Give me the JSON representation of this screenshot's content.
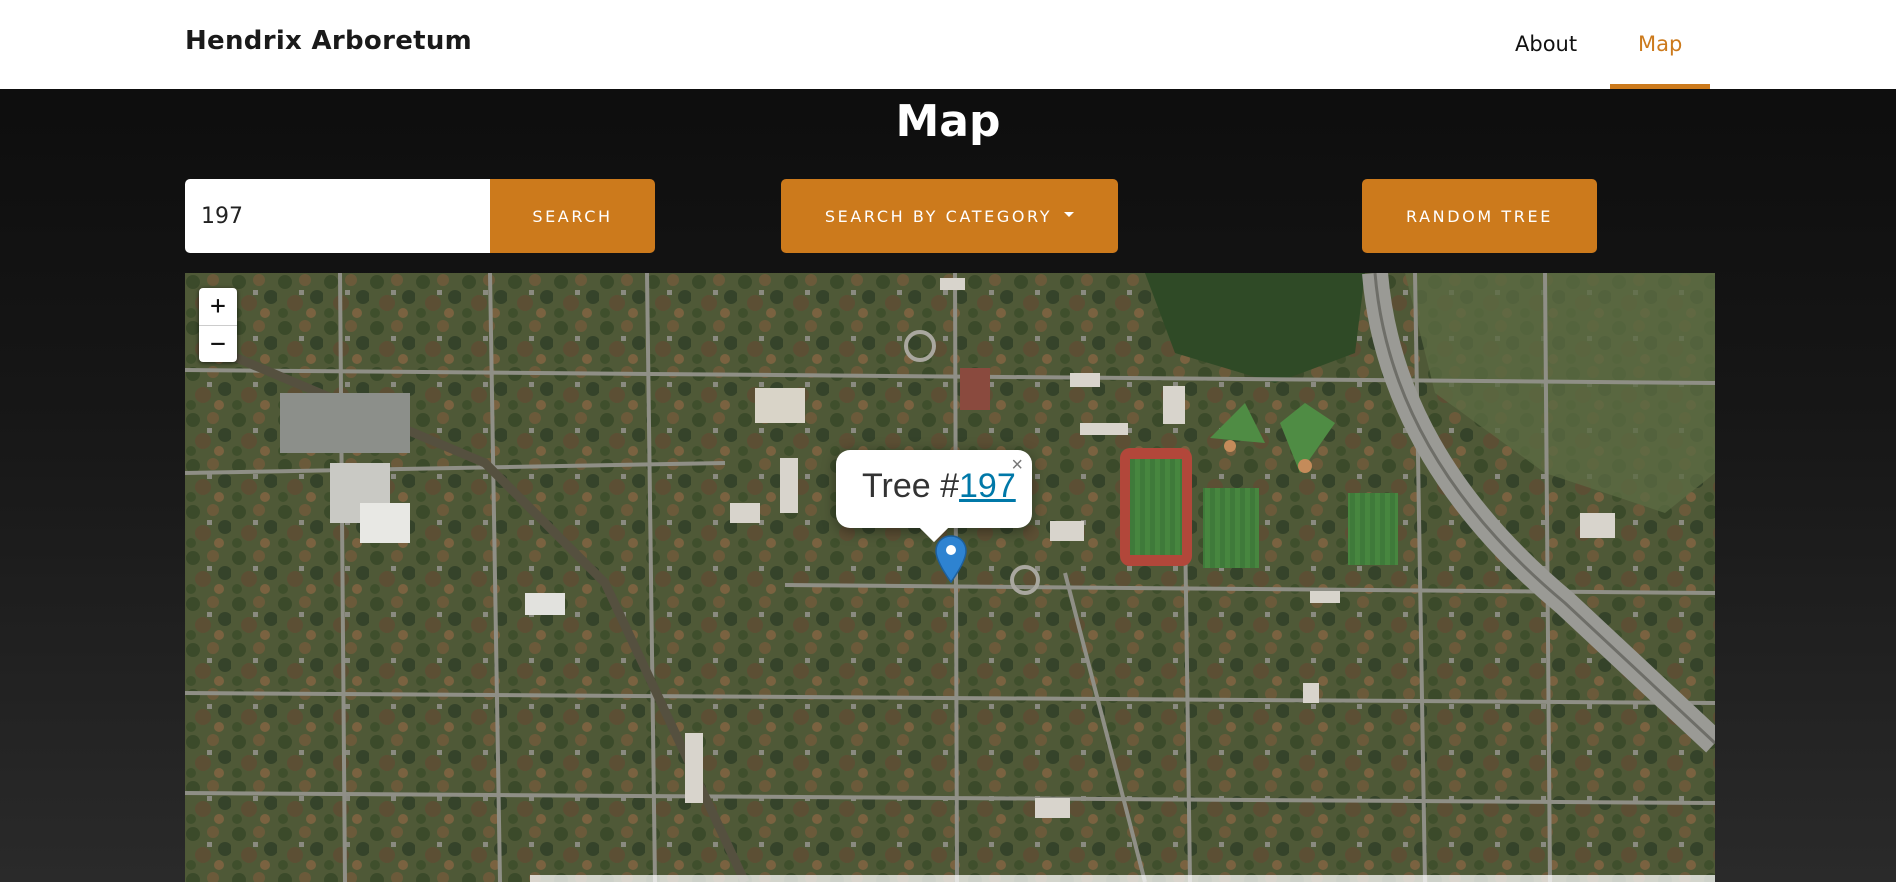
{
  "navbar": {
    "brand": "Hendrix Arboretum",
    "links": [
      {
        "label": "About",
        "active": false
      },
      {
        "label": "Map",
        "active": true
      }
    ],
    "accent_color": "#cc7a1c"
  },
  "main": {
    "title": "Map",
    "search": {
      "value": "197",
      "button_label": "Search"
    },
    "category_button": {
      "label": "Search by Category",
      "icon": "caret-down-icon"
    },
    "random_button": {
      "label": "Random Tree"
    }
  },
  "map": {
    "zoom_in_label": "+",
    "zoom_out_label": "−",
    "popup": {
      "prefix": "Tree #",
      "tree_id": "197",
      "close_label": "×"
    },
    "marker_icon": "map-pin-icon"
  }
}
